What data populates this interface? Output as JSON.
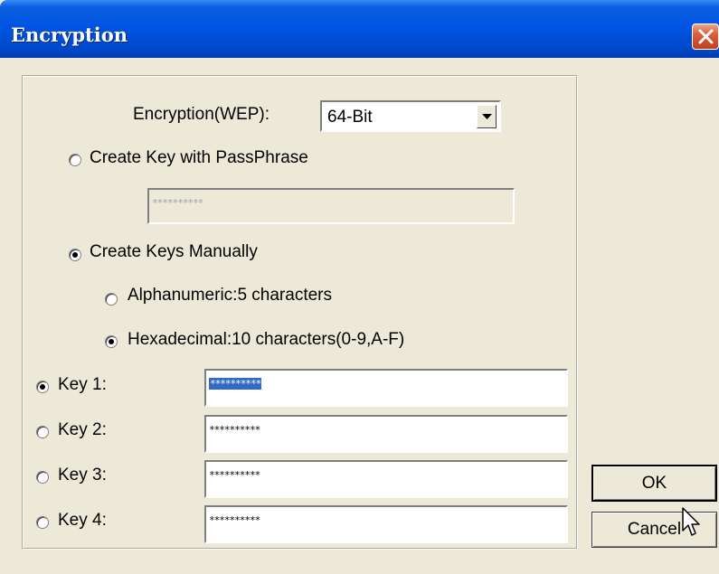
{
  "window": {
    "title": "Encryption"
  },
  "encryption": {
    "label": "Encryption(WEP):",
    "selected": "64-Bit"
  },
  "passphrase": {
    "label": "Create Key with PassPhrase",
    "value": "**********"
  },
  "manual": {
    "label": "Create Keys Manually"
  },
  "alnum": {
    "label": "Alphanumeric:5 characters"
  },
  "hex": {
    "label": "Hexadecimal:10 characters(0-9,A-F)"
  },
  "keys": [
    {
      "label": "Key 1:",
      "value": "**********",
      "selected": true
    },
    {
      "label": "Key 2:",
      "value": "**********",
      "selected": false
    },
    {
      "label": "Key 3:",
      "value": "**********",
      "selected": false
    },
    {
      "label": "Key 4:",
      "value": "**********",
      "selected": false
    }
  ],
  "buttons": {
    "ok": "OK",
    "cancel": "Cancel"
  },
  "icons": {
    "close": "close-icon",
    "dropdown": "chevron-down-icon",
    "cursor": "mouse-pointer-icon"
  }
}
